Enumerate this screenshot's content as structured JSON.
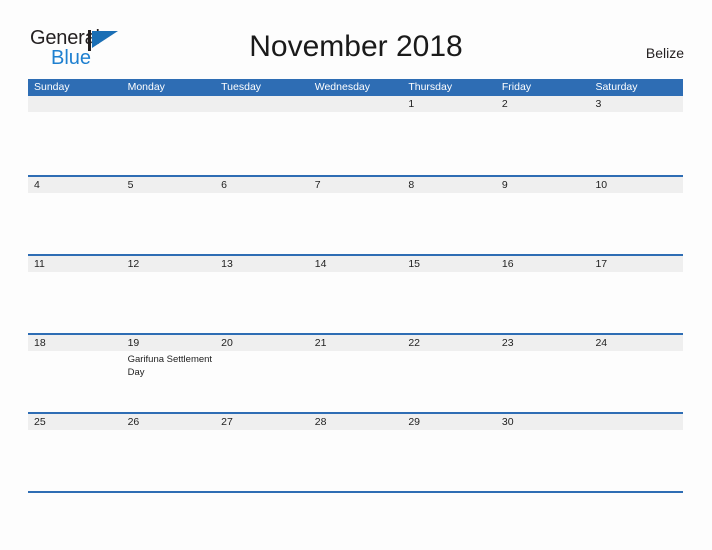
{
  "brand": {
    "line1": "General",
    "line2": "Blue",
    "flag_icon": "flag-triangle-icon"
  },
  "header": {
    "title": "November 2018",
    "country": "Belize"
  },
  "colors": {
    "header_blue": "#2e6db4",
    "band_gray": "#efefef",
    "brand_blue": "#1f80d0",
    "text": "#222222",
    "page_background": "#fdfdfd"
  },
  "calendar": {
    "day_headers": [
      "Sunday",
      "Monday",
      "Tuesday",
      "Wednesday",
      "Thursday",
      "Friday",
      "Saturday"
    ],
    "weeks": [
      {
        "days": [
          {
            "date": "",
            "events": []
          },
          {
            "date": "",
            "events": []
          },
          {
            "date": "",
            "events": []
          },
          {
            "date": "",
            "events": []
          },
          {
            "date": "1",
            "events": []
          },
          {
            "date": "2",
            "events": []
          },
          {
            "date": "3",
            "events": []
          }
        ]
      },
      {
        "days": [
          {
            "date": "4",
            "events": []
          },
          {
            "date": "5",
            "events": []
          },
          {
            "date": "6",
            "events": []
          },
          {
            "date": "7",
            "events": []
          },
          {
            "date": "8",
            "events": []
          },
          {
            "date": "9",
            "events": []
          },
          {
            "date": "10",
            "events": []
          }
        ]
      },
      {
        "days": [
          {
            "date": "11",
            "events": []
          },
          {
            "date": "12",
            "events": []
          },
          {
            "date": "13",
            "events": []
          },
          {
            "date": "14",
            "events": []
          },
          {
            "date": "15",
            "events": []
          },
          {
            "date": "16",
            "events": []
          },
          {
            "date": "17",
            "events": []
          }
        ]
      },
      {
        "days": [
          {
            "date": "18",
            "events": []
          },
          {
            "date": "19",
            "events": [
              "Garifuna Settlement Day"
            ]
          },
          {
            "date": "20",
            "events": []
          },
          {
            "date": "21",
            "events": []
          },
          {
            "date": "22",
            "events": []
          },
          {
            "date": "23",
            "events": []
          },
          {
            "date": "24",
            "events": []
          }
        ]
      },
      {
        "days": [
          {
            "date": "25",
            "events": []
          },
          {
            "date": "26",
            "events": []
          },
          {
            "date": "27",
            "events": []
          },
          {
            "date": "28",
            "events": []
          },
          {
            "date": "29",
            "events": []
          },
          {
            "date": "30",
            "events": []
          },
          {
            "date": "",
            "events": []
          }
        ]
      }
    ]
  }
}
